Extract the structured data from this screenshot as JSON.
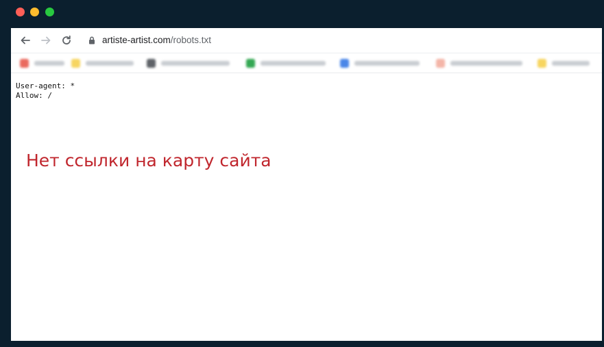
{
  "window": {
    "controls": [
      {
        "name": "close",
        "color": "#ff5f57"
      },
      {
        "name": "minimize",
        "color": "#febc2e"
      },
      {
        "name": "maximize",
        "color": "#28c840"
      }
    ]
  },
  "toolbar": {
    "back_icon": "arrow-left-icon",
    "forward_icon": "arrow-right-icon",
    "reload_icon": "reload-icon",
    "lock_icon": "lock-icon",
    "url_host": "artiste-artist.com",
    "url_path": "/robots.txt"
  },
  "bookmarks": [
    {
      "icon_color": "#ea6a5e"
    },
    {
      "icon_color": "#f7d560"
    },
    {
      "icon_color": "#5f6368"
    },
    {
      "icon_color": "#34a853"
    },
    {
      "icon_color": "#4a86e8"
    },
    {
      "icon_color": "#f4b5a8"
    },
    {
      "icon_color": "#f7d560"
    }
  ],
  "robots_txt": {
    "lines": [
      "User-agent: *",
      "Allow: /"
    ]
  },
  "annotation": {
    "text": "Нет ссылки на карту сайта",
    "color": "#c0262d"
  }
}
